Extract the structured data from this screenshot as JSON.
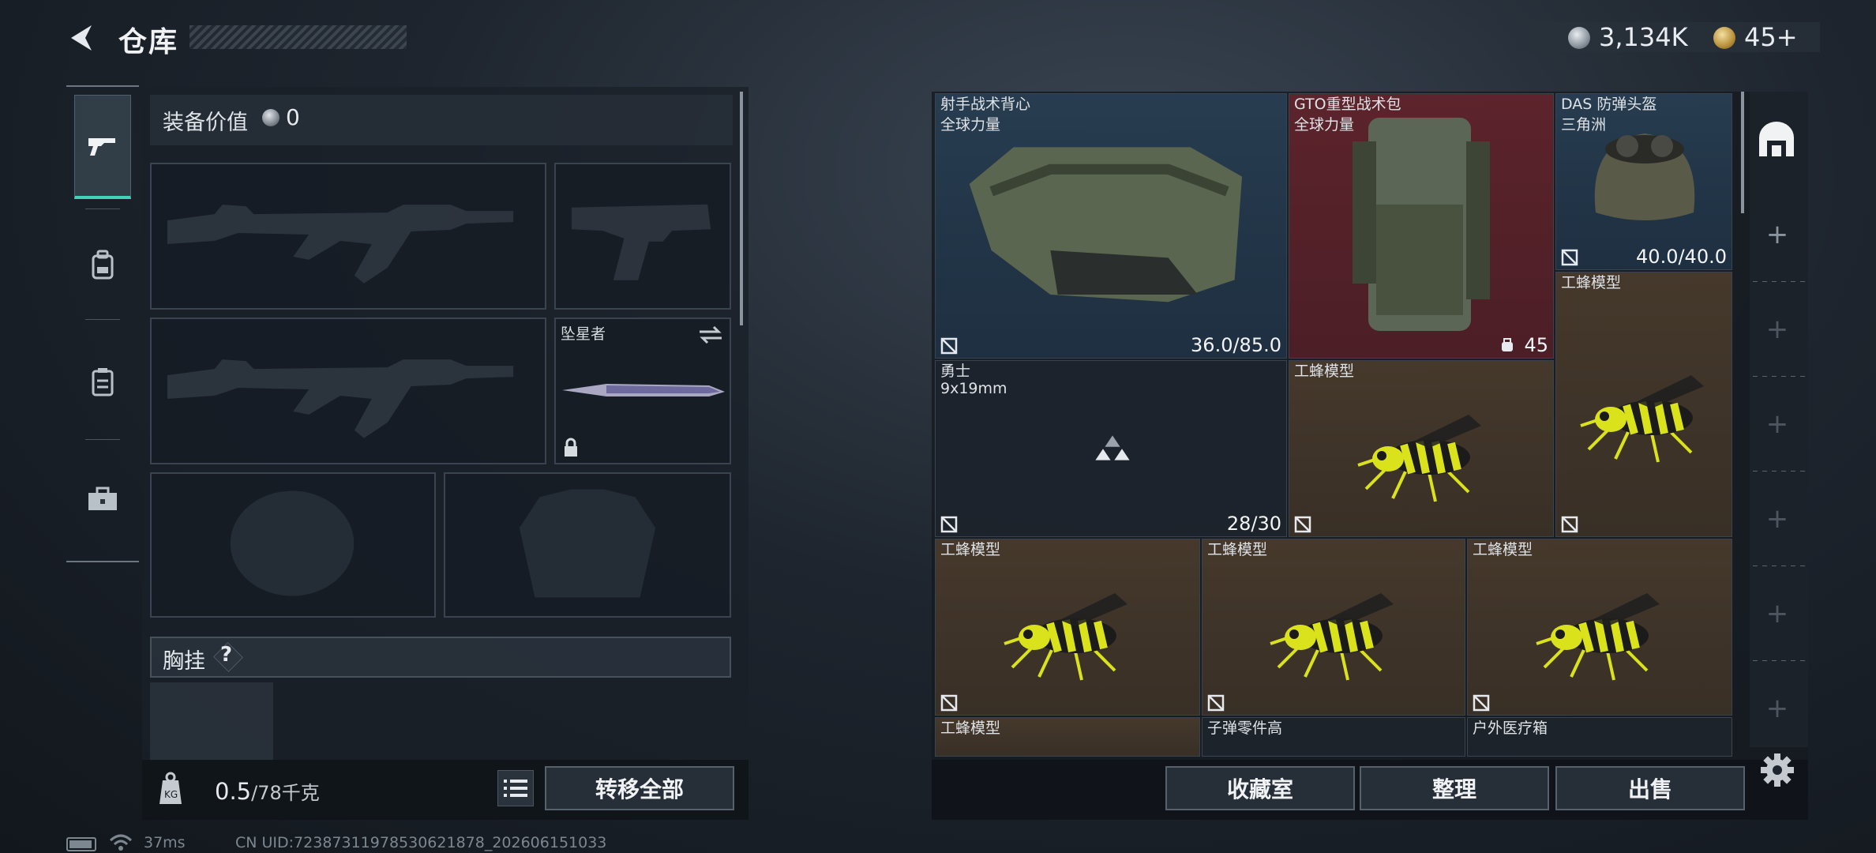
{
  "header": {
    "title": "仓库",
    "currency_silver": "3,134K",
    "currency_gold": "45+"
  },
  "left_tabs": [
    {
      "icon": "pistol-icon",
      "active": true
    },
    {
      "icon": "backpack-icon",
      "active": false
    },
    {
      "icon": "clipboard-icon",
      "active": false
    },
    {
      "icon": "toolbox-icon",
      "active": false
    }
  ],
  "loadout": {
    "equipment_value_label": "装备价值",
    "equipment_value": "0",
    "melee_slot_name": "坠星者",
    "chest_rig_label": "胸挂",
    "help_mark": "?",
    "weight_current": "0.5",
    "weight_max": "/78千克",
    "transfer_all_label": "转移全部"
  },
  "items": [
    {
      "name": "射手战术背心",
      "sub": "全球力量",
      "value": "36.0/85.0",
      "rarity": "blue"
    },
    {
      "name": "GTO重型战术包",
      "sub": "全球力量",
      "value": "45",
      "rarity": "red"
    },
    {
      "name": "DAS 防弹头盔",
      "sub": "三角洲",
      "value": "40.0/40.0",
      "rarity": "blue"
    },
    {
      "name": "工蜂模型",
      "sub": "",
      "value": "",
      "rarity": "brown"
    },
    {
      "name": "勇士",
      "sub": "9x19mm",
      "value": "28/30",
      "rarity": "dark"
    },
    {
      "name": "工蜂模型",
      "sub": "",
      "value": "",
      "rarity": "brown"
    },
    {
      "name": "工蜂模型",
      "sub": "",
      "value": "",
      "rarity": "brown"
    },
    {
      "name": "工蜂模型",
      "sub": "",
      "value": "",
      "rarity": "brown"
    },
    {
      "name": "工蜂模型",
      "sub": "",
      "value": "",
      "rarity": "brown"
    },
    {
      "name": "工蜂模型",
      "sub": "",
      "value": "",
      "rarity": "brown"
    },
    {
      "name": "子弹零件高",
      "sub": "",
      "value": "",
      "rarity": "dark"
    },
    {
      "name": "户外医疗箱",
      "sub": "",
      "value": "",
      "rarity": "dark"
    }
  ],
  "stash_actions": {
    "collection_label": "收藏室",
    "sort_label": "整理",
    "sell_label": "出售"
  },
  "statusbar": {
    "ping": "37ms",
    "uid": "CN UID:7238731197853062187​8_202606151033"
  },
  "colors": {
    "accent": "#3fd4b7",
    "rarity_blue": "#2a4358",
    "rarity_red": "#5c232b",
    "rarity_brown": "#463a2c"
  }
}
